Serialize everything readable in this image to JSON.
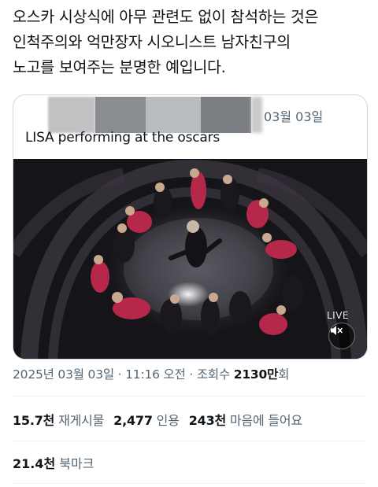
{
  "tweet": {
    "lines": [
      "오스카 시상식에 아무 관련도 없이 참석하는 것은",
      "인척주의와 억만장자 시오니스트 남자친구의",
      "노고를 보여주는 분명한 예입니다."
    ]
  },
  "quote": {
    "date": "03월 03일",
    "text": "LISA performing at the oscars",
    "live_label": "LIVE",
    "mute_icon": "speaker-muted-icon"
  },
  "meta": {
    "date": "2025년 03월 03일",
    "sep1": " · ",
    "time": "11:16 오전",
    "sep2": " · ",
    "views_label": "조회수 ",
    "views_num": "2130만",
    "views_suffix": "회"
  },
  "stats": {
    "reposts_num": "15.7천",
    "reposts_label": " 재게시물",
    "quotes_num": "2,477",
    "quotes_label": " 인용",
    "likes_num": "243천",
    "likes_label": " 마음에 들어요"
  },
  "bookmarks": {
    "num": "21.4천",
    "label": " 북마크"
  },
  "colors": {
    "text": "#0f1419",
    "muted": "#536471",
    "border": "#cfd9de",
    "dress_red": "#b5284a"
  }
}
